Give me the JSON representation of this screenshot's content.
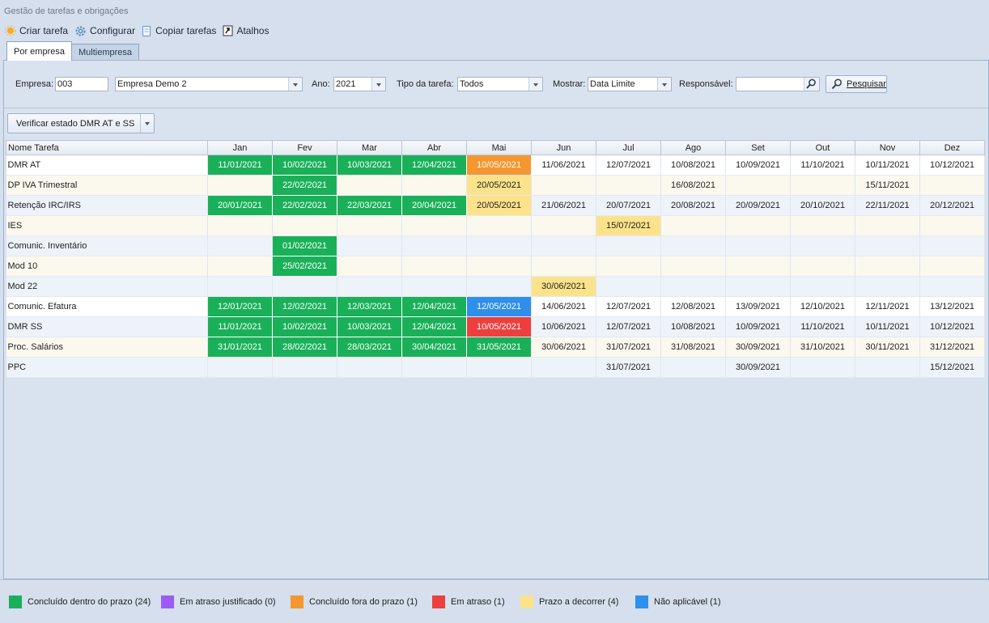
{
  "window_title": "Gestão de tarefas e obrigações",
  "toolbar": {
    "create": "Criar tarefa",
    "configure": "Configurar",
    "copy": "Copiar tarefas",
    "shortcuts": "Atalhos"
  },
  "tabs": [
    "Por empresa",
    "Multiempresa"
  ],
  "filters": {
    "empresa_label": "Empresa:",
    "empresa_code": "003",
    "empresa_name": "Empresa Demo 2",
    "ano_label": "Ano:",
    "ano": "2021",
    "tipo_label": "Tipo da tarefa:",
    "tipo": "Todos",
    "mostrar_label": "Mostrar:",
    "mostrar": "Data Limite",
    "responsavel_label": "Responsável:",
    "responsavel": "",
    "search_button": "Pesquisar"
  },
  "verify_button": "Verificar estado DMR AT e SS",
  "grid": {
    "columns": [
      "Nome Tarefa",
      "Jan",
      "Fev",
      "Mar",
      "Abr",
      "Mai",
      "Jun",
      "Jul",
      "Ago",
      "Set",
      "Out",
      "Nov",
      "Dez"
    ],
    "rows": [
      {
        "name": "DMR AT",
        "cells": [
          [
            "11/01/2021",
            "green"
          ],
          [
            "10/02/2021",
            "green"
          ],
          [
            "10/03/2021",
            "green"
          ],
          [
            "12/04/2021",
            "green"
          ],
          [
            "10/05/2021",
            "orange"
          ],
          [
            "11/06/2021",
            ""
          ],
          [
            "12/07/2021",
            ""
          ],
          [
            "10/08/2021",
            ""
          ],
          [
            "10/09/2021",
            ""
          ],
          [
            "11/10/2021",
            ""
          ],
          [
            "10/11/2021",
            ""
          ],
          [
            "10/12/2021",
            ""
          ]
        ]
      },
      {
        "name": "DP IVA Trimestral",
        "cells": [
          [
            "",
            ""
          ],
          [
            "22/02/2021",
            "green"
          ],
          [
            "",
            ""
          ],
          [
            "",
            ""
          ],
          [
            "20/05/2021",
            "yellow"
          ],
          [
            "",
            ""
          ],
          [
            "",
            ""
          ],
          [
            "16/08/2021",
            ""
          ],
          [
            "",
            ""
          ],
          [
            "",
            ""
          ],
          [
            "15/11/2021",
            ""
          ],
          [
            "",
            ""
          ]
        ]
      },
      {
        "name": "Retenção IRC/IRS",
        "cells": [
          [
            "20/01/2021",
            "green"
          ],
          [
            "22/02/2021",
            "green"
          ],
          [
            "22/03/2021",
            "green"
          ],
          [
            "20/04/2021",
            "green"
          ],
          [
            "20/05/2021",
            "yellow"
          ],
          [
            "21/06/2021",
            ""
          ],
          [
            "20/07/2021",
            ""
          ],
          [
            "20/08/2021",
            ""
          ],
          [
            "20/09/2021",
            ""
          ],
          [
            "20/10/2021",
            ""
          ],
          [
            "22/11/2021",
            ""
          ],
          [
            "20/12/2021",
            ""
          ]
        ]
      },
      {
        "name": "IES",
        "cells": [
          [
            "",
            ""
          ],
          [
            "",
            ""
          ],
          [
            "",
            ""
          ],
          [
            "",
            ""
          ],
          [
            "",
            ""
          ],
          [
            "",
            ""
          ],
          [
            "15/07/2021",
            "yellow"
          ],
          [
            "",
            ""
          ],
          [
            "",
            ""
          ],
          [
            "",
            ""
          ],
          [
            "",
            ""
          ],
          [
            "",
            ""
          ]
        ]
      },
      {
        "name": "Comunic. Inventário",
        "cells": [
          [
            "",
            ""
          ],
          [
            "01/02/2021",
            "green"
          ],
          [
            "",
            ""
          ],
          [
            "",
            ""
          ],
          [
            "",
            ""
          ],
          [
            "",
            ""
          ],
          [
            "",
            ""
          ],
          [
            "",
            ""
          ],
          [
            "",
            ""
          ],
          [
            "",
            ""
          ],
          [
            "",
            ""
          ],
          [
            "",
            ""
          ]
        ]
      },
      {
        "name": "Mod 10",
        "cells": [
          [
            "",
            ""
          ],
          [
            "25/02/2021",
            "green"
          ],
          [
            "",
            ""
          ],
          [
            "",
            ""
          ],
          [
            "",
            ""
          ],
          [
            "",
            ""
          ],
          [
            "",
            ""
          ],
          [
            "",
            ""
          ],
          [
            "",
            ""
          ],
          [
            "",
            ""
          ],
          [
            "",
            ""
          ],
          [
            "",
            ""
          ]
        ]
      },
      {
        "name": "Mod 22",
        "cells": [
          [
            "",
            ""
          ],
          [
            "",
            ""
          ],
          [
            "",
            ""
          ],
          [
            "",
            ""
          ],
          [
            "",
            ""
          ],
          [
            "30/06/2021",
            "yellow"
          ],
          [
            "",
            ""
          ],
          [
            "",
            ""
          ],
          [
            "",
            ""
          ],
          [
            "",
            ""
          ],
          [
            "",
            ""
          ],
          [
            "",
            ""
          ]
        ]
      },
      {
        "name": "Comunic. Efatura",
        "cells": [
          [
            "12/01/2021",
            "green"
          ],
          [
            "12/02/2021",
            "green"
          ],
          [
            "12/03/2021",
            "green"
          ],
          [
            "12/04/2021",
            "green"
          ],
          [
            "12/05/2021",
            "blue"
          ],
          [
            "14/06/2021",
            ""
          ],
          [
            "12/07/2021",
            ""
          ],
          [
            "12/08/2021",
            ""
          ],
          [
            "13/09/2021",
            ""
          ],
          [
            "12/10/2021",
            ""
          ],
          [
            "12/11/2021",
            ""
          ],
          [
            "13/12/2021",
            ""
          ]
        ]
      },
      {
        "name": "DMR SS",
        "cells": [
          [
            "11/01/2021",
            "green"
          ],
          [
            "10/02/2021",
            "green"
          ],
          [
            "10/03/2021",
            "green"
          ],
          [
            "12/04/2021",
            "green"
          ],
          [
            "10/05/2021",
            "red"
          ],
          [
            "10/06/2021",
            ""
          ],
          [
            "12/07/2021",
            ""
          ],
          [
            "10/08/2021",
            ""
          ],
          [
            "10/09/2021",
            ""
          ],
          [
            "11/10/2021",
            ""
          ],
          [
            "10/11/2021",
            ""
          ],
          [
            "10/12/2021",
            ""
          ]
        ]
      },
      {
        "name": "Proc. Salários",
        "cells": [
          [
            "31/01/2021",
            "green"
          ],
          [
            "28/02/2021",
            "green"
          ],
          [
            "28/03/2021",
            "green"
          ],
          [
            "30/04/2021",
            "green"
          ],
          [
            "31/05/2021",
            "green"
          ],
          [
            "30/06/2021",
            ""
          ],
          [
            "31/07/2021",
            ""
          ],
          [
            "31/08/2021",
            ""
          ],
          [
            "30/09/2021",
            ""
          ],
          [
            "31/10/2021",
            ""
          ],
          [
            "30/11/2021",
            ""
          ],
          [
            "31/12/2021",
            ""
          ]
        ]
      },
      {
        "name": "PPC",
        "cells": [
          [
            "",
            ""
          ],
          [
            "",
            ""
          ],
          [
            "",
            ""
          ],
          [
            "",
            ""
          ],
          [
            "",
            ""
          ],
          [
            "",
            ""
          ],
          [
            "31/07/2021",
            ""
          ],
          [
            "",
            ""
          ],
          [
            "30/09/2021",
            ""
          ],
          [
            "",
            ""
          ],
          [
            "",
            ""
          ],
          [
            "15/12/2021",
            ""
          ]
        ]
      }
    ]
  },
  "legend": [
    {
      "label": "Concluído dentro do prazo (24)",
      "color": "#1ab059"
    },
    {
      "label": "Em atraso justificado (0)",
      "color": "#9b5cf6"
    },
    {
      "label": "Concluído fora do prazo (1)",
      "color": "#f5962f"
    },
    {
      "label": "Em atraso (1)",
      "color": "#ee3f3f"
    },
    {
      "label": "Prazo a decorrer (4)",
      "color": "#fce38b"
    },
    {
      "label": "Não aplicável (1)",
      "color": "#2e8fec"
    }
  ]
}
